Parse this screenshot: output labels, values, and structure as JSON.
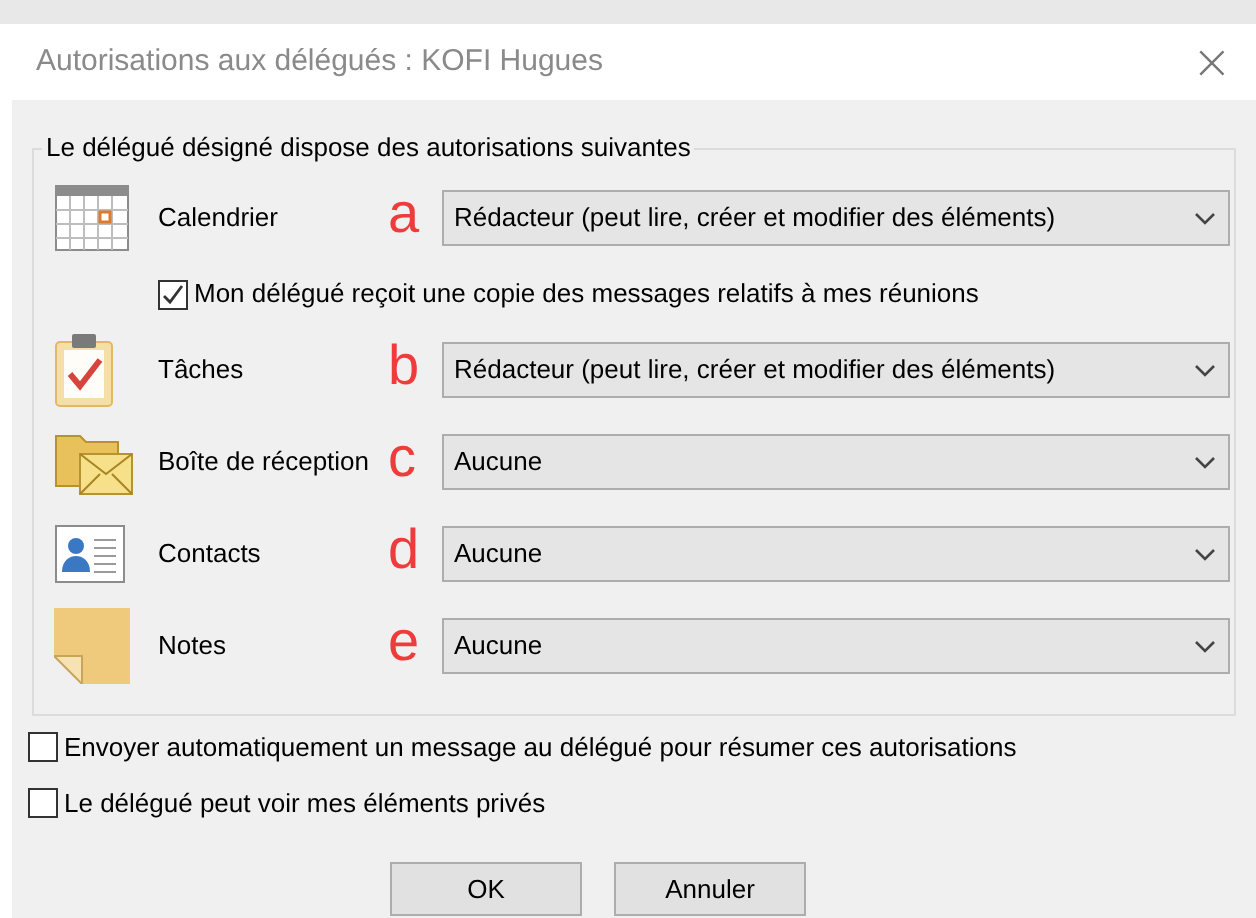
{
  "window": {
    "title": "Autorisations aux délégués : KOFI Hugues",
    "close": "×"
  },
  "group": {
    "legend": "Le délégué désigné dispose des autorisations suivantes",
    "folders": [
      {
        "kind": "calendar",
        "label": "Calendrier",
        "marker": "a",
        "value": "Rédacteur (peut lire, créer et modifier des éléments)",
        "option": {
          "label": "Mon délégué reçoit une copie des messages relatifs à mes réunions",
          "checked": true
        }
      },
      {
        "kind": "tasks",
        "label": "Tâches",
        "marker": "b",
        "value": "Rédacteur (peut lire, créer et modifier des éléments)"
      },
      {
        "kind": "inbox",
        "label": "Boîte de réception",
        "marker": "c",
        "value": "Aucune"
      },
      {
        "kind": "contacts",
        "label": "Contacts",
        "marker": "d",
        "value": "Aucune"
      },
      {
        "kind": "notes",
        "label": "Notes",
        "marker": "e",
        "value": "Aucune"
      }
    ]
  },
  "options": [
    {
      "label": "Envoyer automatiquement un message au délégué pour résumer ces autorisations",
      "checked": false
    },
    {
      "label": "Le délégué peut voir mes éléments privés",
      "checked": false
    }
  ],
  "buttons": [
    "OK",
    "Annuler"
  ]
}
